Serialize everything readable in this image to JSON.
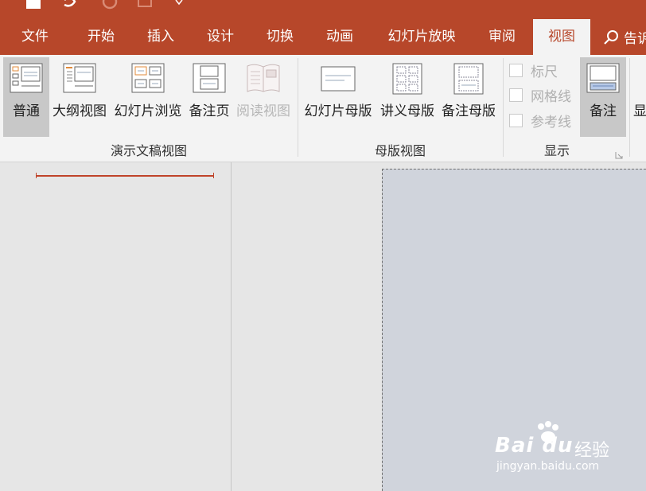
{
  "colors": {
    "accent": "#b7472a",
    "ribbon_bg": "#f3f3f3",
    "slide_bg": "#d0d4dc"
  },
  "quick_access": {
    "icons": [
      "save-icon",
      "undo-icon",
      "redo-icon",
      "presenter-icon"
    ]
  },
  "tabs": [
    {
      "label": "文件"
    },
    {
      "label": "开始"
    },
    {
      "label": "插入"
    },
    {
      "label": "设计"
    },
    {
      "label": "切换"
    },
    {
      "label": "动画"
    },
    {
      "label": "幻灯片放映"
    },
    {
      "label": "审阅"
    },
    {
      "label": "视图",
      "active": true
    }
  ],
  "tell_me": {
    "label": "告诉"
  },
  "ribbon": {
    "presentation_views": {
      "label": "演示文稿视图",
      "buttons": [
        {
          "label": "普通",
          "selected": true
        },
        {
          "label": "大纲视图"
        },
        {
          "label": "幻灯片浏览"
        },
        {
          "label": "备注页"
        },
        {
          "label": "阅读视图",
          "disabled": true
        }
      ]
    },
    "master_views": {
      "label": "母版视图",
      "buttons": [
        {
          "label": "幻灯片母版"
        },
        {
          "label": "讲义母版"
        },
        {
          "label": "备注母版"
        }
      ]
    },
    "show": {
      "label": "显示",
      "checkboxes": [
        {
          "label": "标尺",
          "checked": false
        },
        {
          "label": "网格线",
          "checked": false
        },
        {
          "label": "参考线",
          "checked": false
        }
      ]
    },
    "notes_button": {
      "label": "备注",
      "selected": true
    },
    "next_group_partial": {
      "label": "显"
    }
  },
  "watermark": {
    "brand": "Bai du",
    "jy": "经验",
    "url": "jingyan.baidu.com"
  }
}
